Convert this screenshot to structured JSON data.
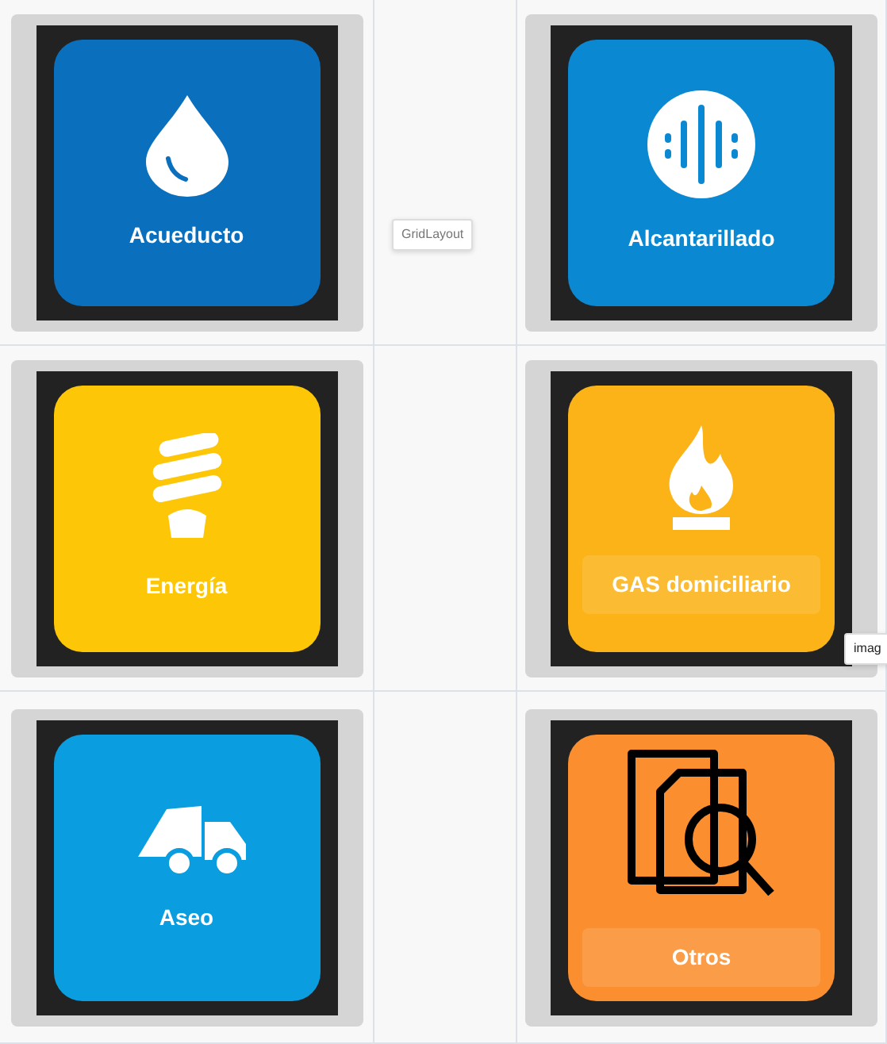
{
  "tiles": [
    {
      "label": "Acueducto",
      "color": "#0a6fbd",
      "kind": "drop",
      "label_band": false
    },
    {
      "label": "Alcantarillado",
      "color": "#0a88d2",
      "kind": "drain",
      "label_band": false
    },
    {
      "label": "Energía",
      "color": "#fdc607",
      "kind": "bulb",
      "label_band": false
    },
    {
      "label": "GAS domiciliario",
      "color": "#fbb317",
      "kind": "flame",
      "label_band": true
    },
    {
      "label": "Aseo",
      "color": "#0a9ddf",
      "kind": "truck",
      "label_band": false
    },
    {
      "label": "Otros",
      "color": "#fb8f2f",
      "kind": "search",
      "label_band": true
    }
  ],
  "tooltips": [
    {
      "text": "GridLayout",
      "kind": "layout"
    },
    {
      "text": "imag",
      "kind": "image"
    }
  ]
}
